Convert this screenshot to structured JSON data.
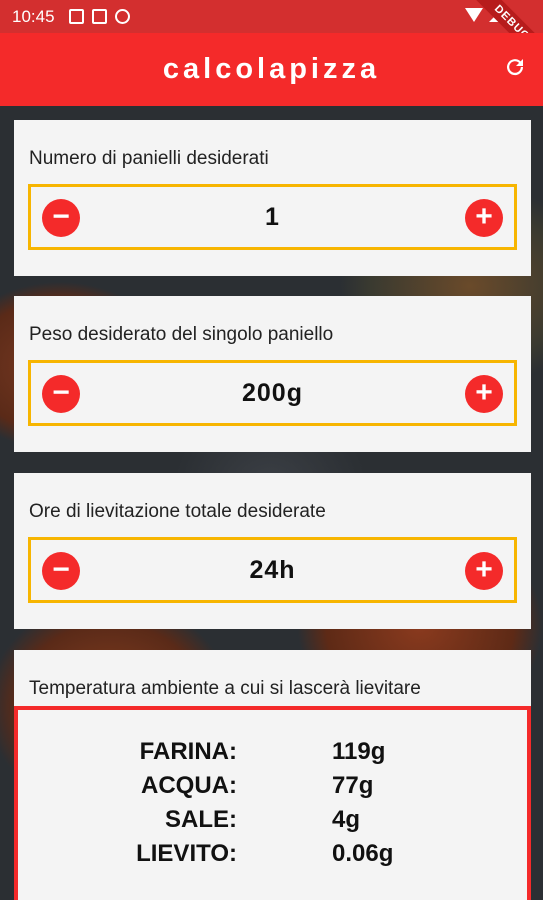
{
  "status_bar": {
    "time": "10:45",
    "icons": [
      "a-icon",
      "sd-card-icon",
      "blocked-icon"
    ],
    "right_icons": [
      "wifi-icon",
      "signal-icon",
      "battery-icon"
    ],
    "debug_banner": "DEBUG"
  },
  "app_bar": {
    "title": "calcolapizza",
    "action_icon": "refresh-icon"
  },
  "cards": [
    {
      "label": "Numero di panielli desiderati",
      "value": "1",
      "minus": "−",
      "plus": "+"
    },
    {
      "label": "Peso desiderato del singolo paniello",
      "value": "200g",
      "minus": "−",
      "plus": "+"
    },
    {
      "label": "Ore di lievitazione totale desiderate",
      "value": "24h",
      "minus": "−",
      "plus": "+"
    },
    {
      "label": "Temperatura ambiente a cui si lascerà lievitare"
    }
  ],
  "results": [
    {
      "label": "FARINA:",
      "value": "119g"
    },
    {
      "label": "ACQUA:",
      "value": "77g"
    },
    {
      "label": "SALE:",
      "value": "4g"
    },
    {
      "label": "LIEVITO:",
      "value": "0.06g"
    }
  ],
  "colors": {
    "primary": "#f42a2a",
    "status_bar": "#d32f2f",
    "stepper_border": "#f7b500",
    "card": "#f4f4f4"
  }
}
